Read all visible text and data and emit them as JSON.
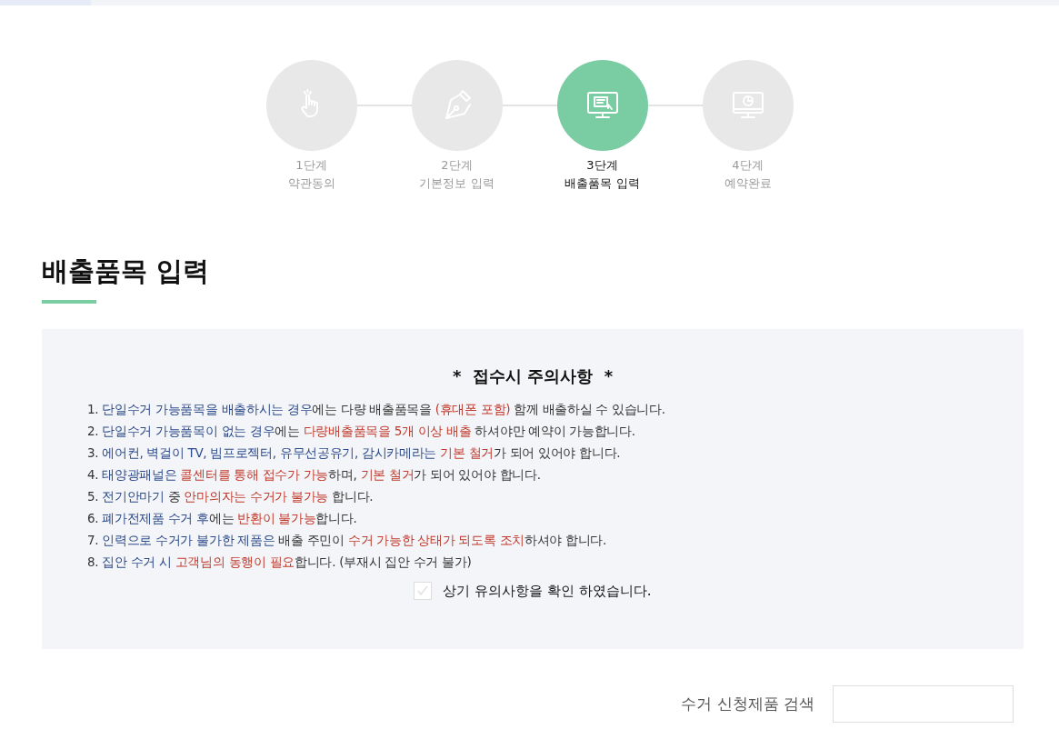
{
  "steps": [
    {
      "kind": "hand",
      "number": "1단계",
      "label": "약관동의",
      "selected": false
    },
    {
      "kind": "pen",
      "number": "2단계",
      "label": "기본정보 입력",
      "selected": false
    },
    {
      "kind": "form",
      "number": "3단계",
      "label": "배출품목 입력",
      "selected": true
    },
    {
      "kind": "clock",
      "number": "4단계",
      "label": "예약완료",
      "selected": false
    }
  ],
  "heading": "배출품목 입력",
  "notice": {
    "title": "*  접수시 주의사항  *",
    "items": [
      {
        "segments": [
          {
            "text": "1. ",
            "color": "#333333"
          },
          {
            "text": "단일수거 가능품목을 배출하시는 경우",
            "color": "#2b4a8b"
          },
          {
            "text": "에는 다량 배출품목을 ",
            "color": "#333333"
          },
          {
            "text": "(휴대폰 포함)",
            "color": "#c0392b"
          },
          {
            "text": " 함께 배출하실 수 있습니다.",
            "color": "#333333"
          }
        ]
      },
      {
        "segments": [
          {
            "text": "2. ",
            "color": "#333333"
          },
          {
            "text": "단일수거 가능품목이 없는 경우",
            "color": "#2b4a8b"
          },
          {
            "text": "에는 ",
            "color": "#333333"
          },
          {
            "text": "다량배출품목을 5개 이상 배출",
            "color": "#c0392b"
          },
          {
            "text": " 하셔야만 예약이 가능합니다.",
            "color": "#333333"
          }
        ]
      },
      {
        "segments": [
          {
            "text": "3. ",
            "color": "#333333"
          },
          {
            "text": "에어컨, 벽걸이 TV, 빔프로젝터, 유무선공유기, 감시카메라는 ",
            "color": "#2b4a8b"
          },
          {
            "text": "기본 철거",
            "color": "#c0392b"
          },
          {
            "text": "가 되어 있어야 합니다.",
            "color": "#333333"
          }
        ]
      },
      {
        "segments": [
          {
            "text": "4. ",
            "color": "#333333"
          },
          {
            "text": "태양광패널은 ",
            "color": "#2b4a8b"
          },
          {
            "text": "콜센터를 통해 접수가 가능",
            "color": "#c0392b"
          },
          {
            "text": "하며, ",
            "color": "#333333"
          },
          {
            "text": "기본 철거",
            "color": "#c0392b"
          },
          {
            "text": "가 되어 있어야 합니다.",
            "color": "#333333"
          }
        ]
      },
      {
        "segments": [
          {
            "text": "5. ",
            "color": "#333333"
          },
          {
            "text": "전기안마기",
            "color": "#2b4a8b"
          },
          {
            "text": " 중 ",
            "color": "#333333"
          },
          {
            "text": "안마의자는 수거가 불가능",
            "color": "#c0392b"
          },
          {
            "text": " 합니다.",
            "color": "#333333"
          }
        ]
      },
      {
        "segments": [
          {
            "text": "6. ",
            "color": "#333333"
          },
          {
            "text": "폐가전제품 수거 후",
            "color": "#2b4a8b"
          },
          {
            "text": "에는 ",
            "color": "#333333"
          },
          {
            "text": "반환이 불가능",
            "color": "#c0392b"
          },
          {
            "text": "합니다.",
            "color": "#333333"
          }
        ]
      },
      {
        "segments": [
          {
            "text": "7. ",
            "color": "#333333"
          },
          {
            "text": "인력으로 수거가 불가한 제품은",
            "color": "#2b4a8b"
          },
          {
            "text": " 배출 주민이 ",
            "color": "#333333"
          },
          {
            "text": "수거 가능한 상태가 되도록 조치",
            "color": "#c0392b"
          },
          {
            "text": "하셔야 합니다.",
            "color": "#333333"
          }
        ]
      },
      {
        "segments": [
          {
            "text": "8. ",
            "color": "#333333"
          },
          {
            "text": "집안 수거 시 ",
            "color": "#2b4a8b"
          },
          {
            "text": "고객님의 동행이 필요",
            "color": "#c0392b"
          },
          {
            "text": "합니다. (부재시 집안 수거 불가)",
            "color": "#333333"
          }
        ]
      }
    ],
    "confirm": {
      "label": "상기 유의사항을 확인 하였습니다.",
      "checked": false
    }
  },
  "search": {
    "label": "수거 신청제품 검색"
  }
}
